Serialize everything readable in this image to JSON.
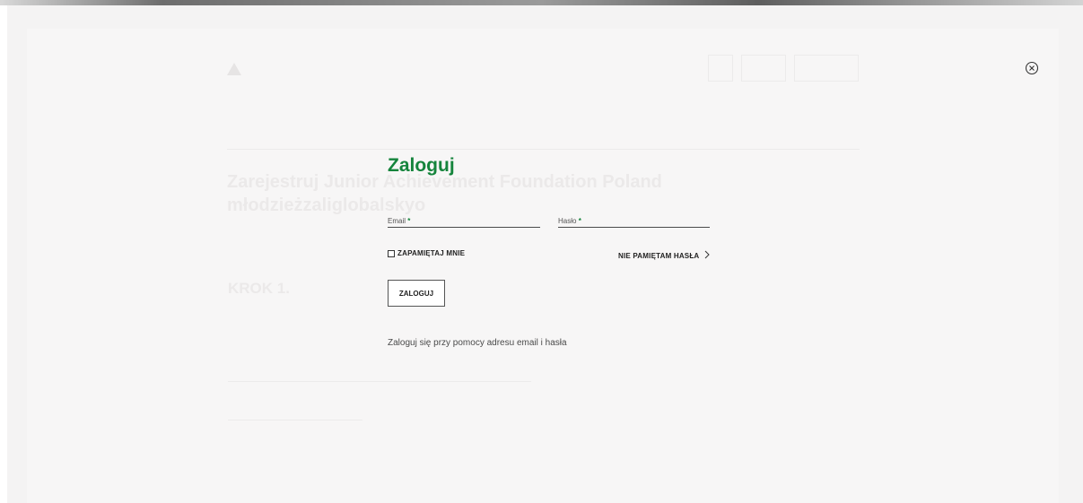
{
  "modal": {
    "title": "Zaloguj",
    "email_label": "Email",
    "password_label": "Hasło",
    "required_mark": "*",
    "remember_label": "ZAPAMIĘTAJ MNIE",
    "forgot_label": "NIE PAMIĘTAM HASŁA",
    "submit_label": "ZALOGUJ",
    "hint": "Zaloguj się przy pomocy adresu email i hasła"
  },
  "background": {
    "title": "Zarejestruj Junior Achievement Foundation Poland młodzieżzaliglobalskyo",
    "step": "KROK 1."
  },
  "colors": {
    "accent": "#15843c",
    "overlay": "#f7f6f6"
  },
  "icons": {
    "close": "close-circle-icon",
    "forgot": "chevron-right-icon"
  }
}
